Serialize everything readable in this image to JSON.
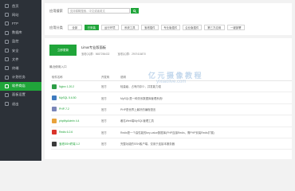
{
  "sidebar": {
    "items": [
      {
        "label": "首页",
        "icon": "home-icon"
      },
      {
        "label": "网站",
        "icon": "globe-icon"
      },
      {
        "label": "FTP",
        "icon": "ftp-icon"
      },
      {
        "label": "数据库",
        "icon": "database-icon"
      },
      {
        "label": "监控",
        "icon": "monitor-icon"
      },
      {
        "label": "安全",
        "icon": "shield-icon"
      },
      {
        "label": "文件",
        "icon": "folder-icon"
      },
      {
        "label": "终端",
        "icon": "terminal-icon"
      },
      {
        "label": "计划任务",
        "icon": "clock-icon"
      },
      {
        "label": "软件商店",
        "icon": "store-icon"
      },
      {
        "label": "面板设置",
        "icon": "gear-icon"
      },
      {
        "label": "退出",
        "icon": "logout-icon"
      }
    ],
    "active_index": 9
  },
  "search": {
    "label": "应用搜索",
    "placeholder": "支持模糊搜索，中文或者英文"
  },
  "categories": {
    "label": "应用分类",
    "items": [
      "全部",
      "已安装",
      "运行环境",
      "系统工具",
      "宝塔插件",
      "专业版插件",
      "企业版插件",
      "第三方应用",
      "一键部署"
    ],
    "active_index": 1
  },
  "linux_panel": {
    "button_label": "立即更新",
    "title": "Linux专业版面板",
    "qq_group_1": "宝塔QQ群：5687256432",
    "qq_group_2": "宝塔QQ群：2907416870"
  },
  "recent_label": "最近使用入口",
  "table": {
    "headers": [
      "软件名称",
      "开发商",
      "说明"
    ],
    "rows": [
      {
        "name": "Nginx 1.20.2",
        "vendor": "官方",
        "desc": "轻量级，占有内存少，并发能力强",
        "color": "#2e9e47"
      },
      {
        "name": "MySQL 5.6.50",
        "vendor": "官方",
        "desc": "MySQL是一种关系数据库管理系统!",
        "color": "#3f7bbf"
      },
      {
        "name": "PHP-7.2",
        "vendor": "官方",
        "desc": "PHP是世界上最好的编程语言",
        "color": "#7a86b8"
      },
      {
        "name": "phpMyAdmin 4.4",
        "vendor": "官方",
        "desc": "著名Web端MySQL管理工具",
        "color": "#e8a23b"
      },
      {
        "name": "Redis 6.2.6",
        "vendor": "官方",
        "desc": "Redis是一个高性能的key-value数据库(PHP连接Redis，需PHP安装Redis扩展)",
        "color": "#d9342b"
      },
      {
        "name": "宝塔SSH终端 1.2",
        "vendor": "官方",
        "desc": "完整功能的SSH客户端，仅用于连接本服务器",
        "color": "#3b3b3b"
      }
    ]
  },
  "watermark": {
    "line1": "亿 元 摄 像 教 程",
    "line2": "yixiaolive.com"
  }
}
